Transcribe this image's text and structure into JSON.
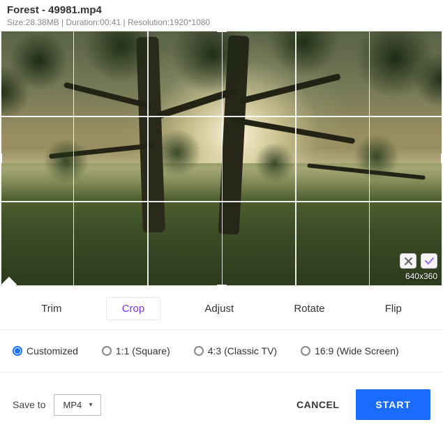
{
  "header": {
    "title": "Forest - 49981.mp4",
    "meta": "Size:28.38MB | Duration:00:41 | Resolution:1920*1080"
  },
  "preview": {
    "crop_dimensions": "640x360"
  },
  "tabs": [
    {
      "label": "Trim",
      "active": false
    },
    {
      "label": "Crop",
      "active": true
    },
    {
      "label": "Adjust",
      "active": false
    },
    {
      "label": "Rotate",
      "active": false
    },
    {
      "label": "Flip",
      "active": false
    }
  ],
  "crop_options": [
    {
      "label": "Customized",
      "selected": true
    },
    {
      "label": "1:1 (Square)",
      "selected": false
    },
    {
      "label": "4:3 (Classic TV)",
      "selected": false
    },
    {
      "label": "16:9 (Wide Screen)",
      "selected": false
    }
  ],
  "footer": {
    "save_to_label": "Save to",
    "format": "MP4",
    "cancel_label": "CANCEL",
    "start_label": "START"
  }
}
